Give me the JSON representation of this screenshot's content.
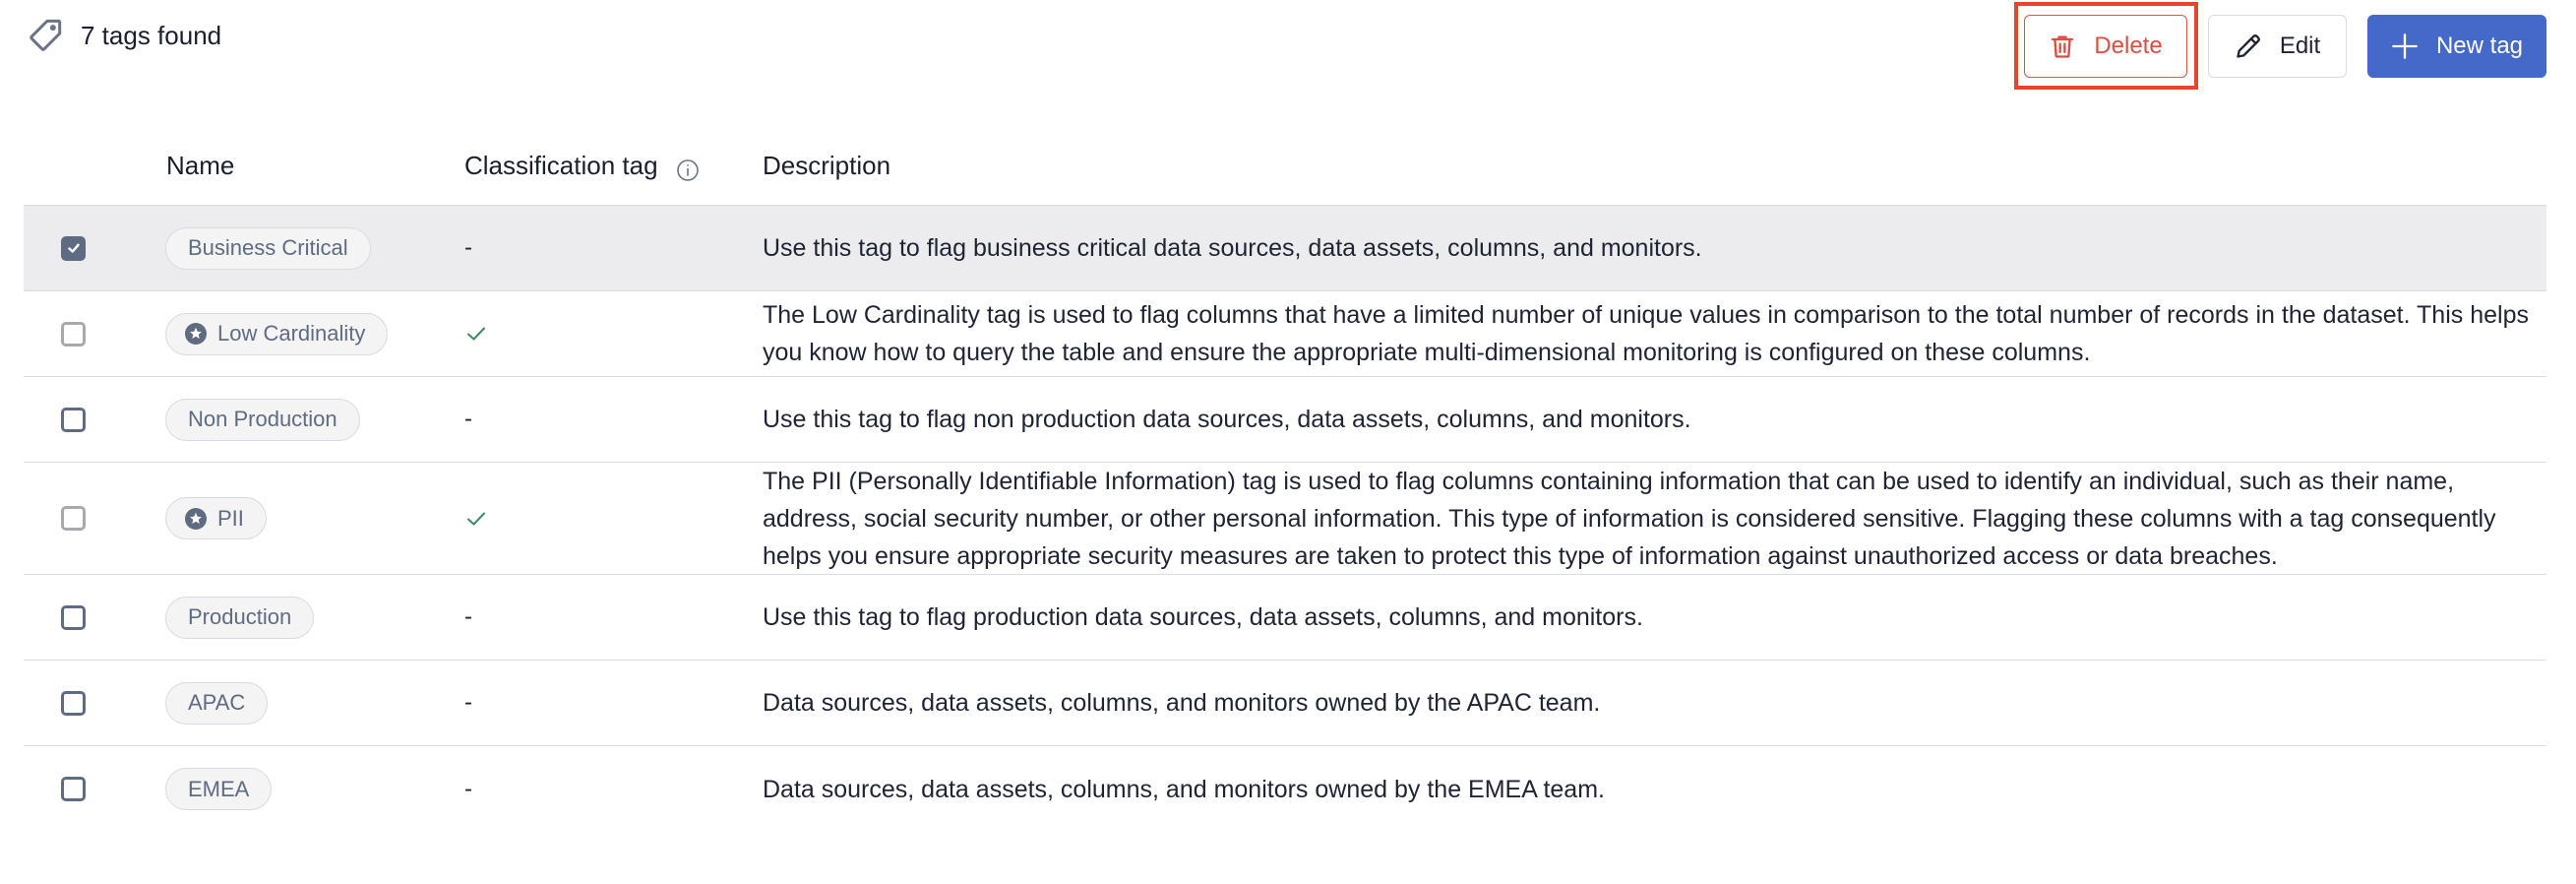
{
  "header": {
    "count_label": "7 tags found",
    "icon": "tag-icon"
  },
  "actions": {
    "delete_label": "Delete",
    "delete_icon": "trash-icon",
    "edit_label": "Edit",
    "edit_icon": "pencil-icon",
    "new_label": "New tag",
    "new_icon": "plus-icon",
    "highlighted": "delete"
  },
  "colors": {
    "primary": "#4469c8",
    "danger": "#df4c40",
    "highlight": "#e8432c",
    "success": "#3d8c5f"
  },
  "table": {
    "columns": {
      "name": "Name",
      "classification": "Classification tag",
      "classification_icon": "info-icon",
      "description": "Description"
    },
    "rows": [
      {
        "selected": true,
        "name": "Business Critical",
        "classification": false,
        "classification_text": "-",
        "description": "Use this tag to flag business critical data sources, data assets, columns, and monitors."
      },
      {
        "selected": false,
        "name": "Low Cardinality",
        "classification": true,
        "classification_text": "✓",
        "description": "The Low Cardinality tag is used to flag columns that have a limited number of unique values in comparison to the total number of records in the dataset. This helps you know how to query the table and ensure the appropriate multi-dimensional monitoring is configured on these columns."
      },
      {
        "selected": false,
        "name": "Non Production",
        "classification": false,
        "classification_text": "-",
        "description": "Use this tag to flag non production data sources, data assets, columns, and monitors."
      },
      {
        "selected": false,
        "name": "PII",
        "classification": true,
        "classification_text": "✓",
        "description": "The PII (Personally Identifiable Information) tag is used to flag columns containing information that can be used to identify an individual, such as their name, address, social security number, or other personal information. This type of information is considered sensitive. Flagging these columns with a tag consequently helps you ensure appropriate security measures are taken to protect this type of information against unauthorized access or data breaches."
      },
      {
        "selected": false,
        "name": "Production",
        "classification": false,
        "classification_text": "-",
        "description": "Use this tag to flag production data sources, data assets, columns, and monitors."
      },
      {
        "selected": false,
        "name": "APAC",
        "classification": false,
        "classification_text": "-",
        "description": "Data sources, data assets, columns, and monitors owned by the APAC team."
      },
      {
        "selected": false,
        "name": "EMEA",
        "classification": false,
        "classification_text": "-",
        "description": "Data sources, data assets, columns, and monitors owned by the EMEA team."
      }
    ]
  }
}
